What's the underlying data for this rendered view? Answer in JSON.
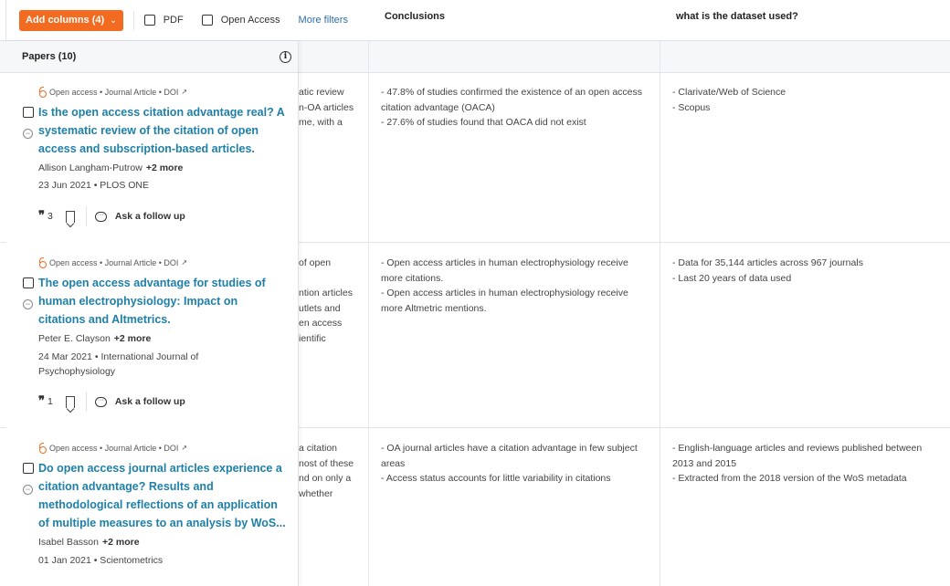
{
  "toolbar": {
    "add_columns_label": "Add columns (4)",
    "chevron_icon": "chevron-down-icon",
    "pdf_label": "PDF",
    "open_access_label": "Open Access",
    "more_filters_label": "More filters"
  },
  "headers": {
    "papers": "Papers (10)",
    "conclusions": "Conclusions",
    "dataset": "what is the dataset used?"
  },
  "papers": [
    {
      "meta": "Open access • Journal Article • DOI",
      "title": "Is the open access citation advantage real? A systematic review of the citation of open access and subscription-based articles.",
      "first_author": "Allison Langham-Putrow",
      "more_authors": "+2 more",
      "pubinfo": "23 Jun 2021 • PLOS ONE",
      "citations": "3",
      "follow_up": "Ask a follow up",
      "hidden_fragment": [
        "atic review",
        "n-OA articles",
        "me, with a"
      ],
      "conclusions": [
        "- 47.8% of studies confirmed the existence of an open access citation advantage (OACA)",
        "- 27.6% of studies found that OACA did not exist"
      ],
      "dataset": [
        "- Clarivate/Web of Science",
        "- Scopus"
      ]
    },
    {
      "meta": "Open access • Journal Article • DOI",
      "title": "The open access advantage for studies of human electrophysiology: Impact on citations and Altmetrics.",
      "first_author": "Peter E. Clayson",
      "more_authors": "+2 more",
      "pubinfo": "24 Mar 2021 • International Journal of Psychophysiology",
      "citations": "1",
      "follow_up": "Ask a follow up",
      "hidden_fragment": [
        "of open",
        "",
        "ntion articles",
        "utlets and",
        "en access",
        "ientific"
      ],
      "conclusions": [
        "- Open access articles in human electrophysiology receive more citations.",
        "- Open access articles in human electrophysiology receive more Altmetric mentions."
      ],
      "dataset": [
        "- Data for 35,144 articles across 967 journals",
        "- Last 20 years of data used"
      ]
    },
    {
      "meta": "Open access • Journal Article • DOI",
      "title": "Do open access journal articles experience a citation advantage? Results and methodological reflections of an application of multiple measures to an analysis by WoS...",
      "first_author": "Isabel Basson",
      "more_authors": "+2 more",
      "pubinfo": "01 Jan 2021 • Scientometrics",
      "hidden_fragment": [
        "a citation",
        "nost of these",
        "nd on only a",
        "whether"
      ],
      "conclusions": [
        "- OA journal articles have a citation advantage in few subject areas",
        "- Access status accounts for little variability in citations"
      ],
      "dataset": [
        "- English-language articles and reviews published between 2013 and 2015",
        "- Extracted from the 2018 version of the WoS metadata"
      ]
    }
  ],
  "colors": {
    "accent": "#f26b21",
    "link": "#1e7fa8",
    "filter_link": "#2b6fa8"
  }
}
